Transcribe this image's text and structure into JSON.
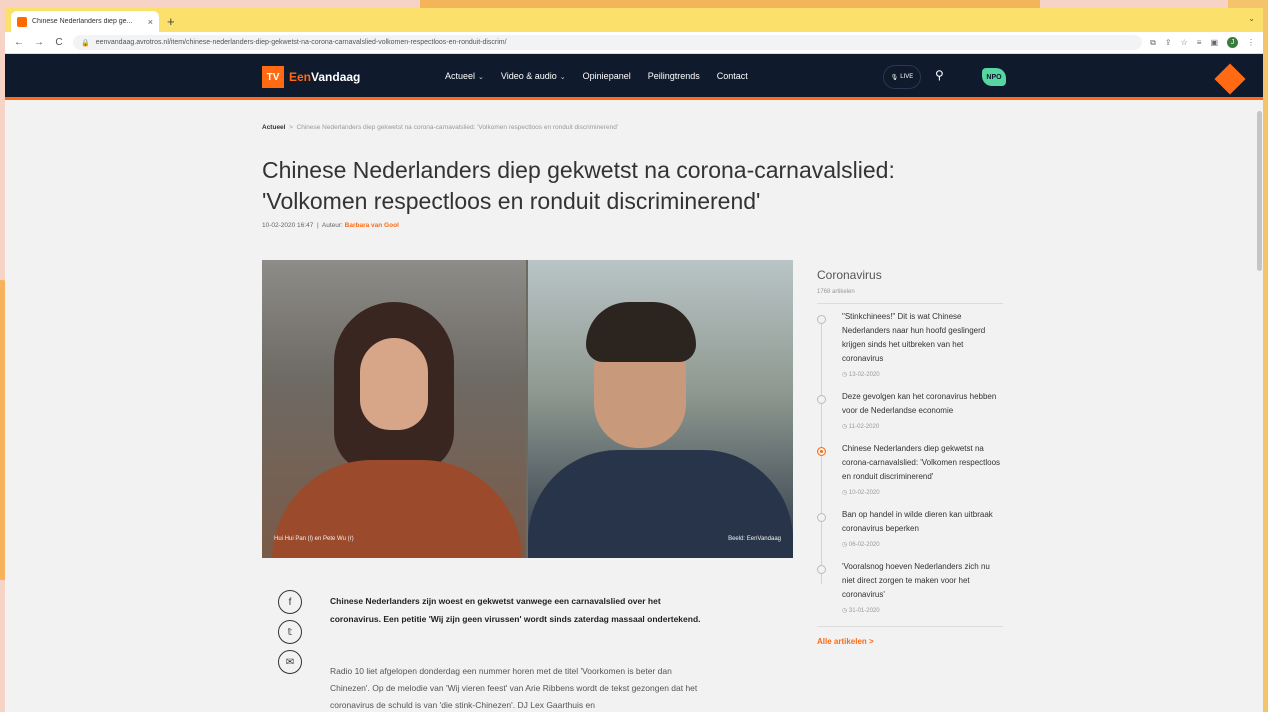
{
  "browser": {
    "tab_title": "Chinese Nederlanders diep ge...",
    "tab_close": "×",
    "new_tab": "+",
    "tab_menu": "⌄",
    "back": "←",
    "forward": "→",
    "reload": "C",
    "lock_icon": "🔒",
    "url": "eenvandaag.avrotros.nl/item/chinese-nederlanders-diep-gekwetst-na-corona-carnavalslied-volkomen-respectloos-en-ronduit-discrim/",
    "profile_initial": "J"
  },
  "site": {
    "logo_tv": "TV",
    "logo_een": "Een",
    "logo_vandaag": "Vandaag",
    "nav": [
      {
        "label": "Actueel",
        "caret": "⌄"
      },
      {
        "label": "Video & audio",
        "caret": "⌄"
      },
      {
        "label": "Opiniepanel"
      },
      {
        "label": "Peilingtrends"
      },
      {
        "label": "Contact"
      }
    ],
    "live_label": "LIVE",
    "npo_label": "NPO"
  },
  "article": {
    "breadcrumb_section": "Actueel",
    "breadcrumb_sep": ">",
    "breadcrumb_current": "Chinese Nederlanders diep gekwetst na corona-carnavalslied: 'Volkomen respectloos en ronduit discriminerend'",
    "title": "Chinese Nederlanders diep gekwetst na corona-carnavalslied: 'Volkomen respectloos en ronduit discriminerend'",
    "date": "10-02-2020 16:47",
    "author_label": "Auteur:",
    "author": "Barbara van Gool",
    "caption_left": "Hui Hui Pan (l) en Pete Wu (r)",
    "caption_right": "Beeld: EenVandaag",
    "intro": "Chinese Nederlanders zijn woest en gekwetst vanwege een carnavalslied over het coronavirus. Een petitie 'Wij zijn geen virussen' wordt sinds zaterdag massaal ondertekend.",
    "body": "Radio 10 liet afgelopen donderdag een nummer horen met de titel 'Voorkomen is beter dan Chinezen'. Op de melodie van 'Wij vieren feest' van Arie Ribbens wordt de tekst gezongen dat het coronavirus de schuld is van 'die stink-Chinezen'. DJ Lex Gaarthuis en"
  },
  "share": [
    "facebook-icon",
    "twitter-icon",
    "email-icon"
  ],
  "sidebar": {
    "title": "Coronavirus",
    "count": "1768 artikelen",
    "items": [
      {
        "text": "\"Stinkchinees!\" Dit is wat Chinese Nederlanders naar hun hoofd geslingerd krijgen sinds het uitbreken van het coronavirus",
        "date": "13-02-2020"
      },
      {
        "text": "Deze gevolgen kan het coronavirus hebben voor de Nederlandse economie",
        "date": "11-02-2020"
      },
      {
        "text": "Chinese Nederlanders diep gekwetst na corona-carnavalslied: 'Volkomen respectloos en ronduit discriminerend'",
        "date": "10-02-2020"
      },
      {
        "text": "Ban op handel in wilde dieren kan uitbraak coronavirus beperken",
        "date": "06-02-2020"
      },
      {
        "text": "'Vooralsnog hoeven Nederlanders zich nu niet direct zorgen te maken voor het coronavirus'",
        "date": "31-01-2020"
      }
    ],
    "all_label": "Alle artikelen >"
  },
  "colors": {
    "accent": "#ff6a13",
    "header": "#0f1a2d",
    "tabbar": "#fbe06b"
  }
}
